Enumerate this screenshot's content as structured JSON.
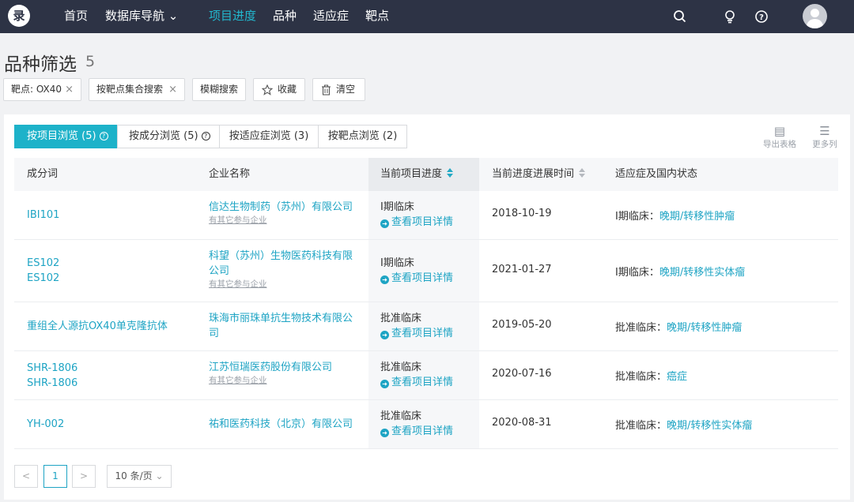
{
  "nav": {
    "logo_glyph": "录",
    "items": [
      "首页",
      "数据库导航 ⌄",
      "项目进度",
      "品种",
      "适应症",
      "靶点"
    ],
    "active_index": 2,
    "accent": "#22b8cf"
  },
  "header": {
    "title": "品种筛选",
    "count": "5",
    "chips": {
      "target": "靶点: OX40",
      "target_set": "按靶点集合搜索",
      "fuzzy": "模糊搜索",
      "favorite": "收藏",
      "clear": "清空"
    }
  },
  "tabs": [
    {
      "label": "按项目浏览 (5)",
      "help": true
    },
    {
      "label": "按成分浏览 (5)",
      "help": true
    },
    {
      "label": "按适应症浏览 (3)",
      "help": false
    },
    {
      "label": "按靶点浏览 (2)",
      "help": false
    }
  ],
  "tools": {
    "export": "导出表格",
    "more_columns": "更多列"
  },
  "table": {
    "headers": [
      "成分词",
      "企业名称",
      "当前项目进度",
      "当前进度进展时间",
      "适应症及国内状态"
    ],
    "detail_label": "查看项目详情",
    "rows": [
      {
        "ingredient": [
          "IBI101"
        ],
        "company": [
          "信达生物制药（苏州）有限公司"
        ],
        "other": "有其它参与企业",
        "stage": "I期临床",
        "date": "2018-10-19",
        "status_prefix": "I期临床：",
        "indication": "晚期/转移性肿瘤"
      },
      {
        "ingredient": [
          "ES102",
          "ES102"
        ],
        "company": [
          "科望（苏州）生物医药科技有限",
          "公司"
        ],
        "other": "有其它参与企业",
        "stage": "I期临床",
        "date": "2021-01-27",
        "status_prefix": "I期临床：",
        "indication": "晚期/转移性实体瘤"
      },
      {
        "ingredient": [
          "重组全人源抗OX40单克隆抗体"
        ],
        "company": [
          "珠海市丽珠单抗生物技术有限公",
          "司"
        ],
        "other": "",
        "stage": "批准临床",
        "date": "2019-05-20",
        "status_prefix": "批准临床：",
        "indication": "晚期/转移性肿瘤"
      },
      {
        "ingredient": [
          "SHR-1806",
          "SHR-1806"
        ],
        "company": [
          "江苏恒瑞医药股份有限公司"
        ],
        "other": "有其它参与企业",
        "stage": "批准临床",
        "date": "2020-07-16",
        "status_prefix": "批准临床：",
        "indication": "癌症"
      },
      {
        "ingredient": [
          "YH-002"
        ],
        "company": [
          "祐和医药科技（北京）有限公司"
        ],
        "other": "",
        "stage": "批准临床",
        "date": "2020-08-31",
        "status_prefix": "批准临床：",
        "indication": "晚期/转移性实体瘤"
      }
    ]
  },
  "pagination": {
    "prev": "<",
    "page": "1",
    "next": ">",
    "page_size": "10 条/页"
  }
}
